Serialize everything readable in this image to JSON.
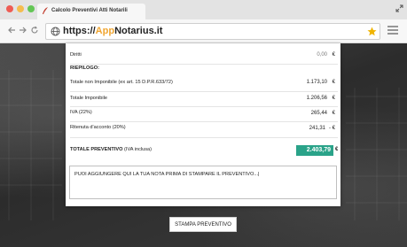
{
  "browser": {
    "tab_title": "Calcolo Preventivi Atti Notarili",
    "url_prefix": "https://",
    "url_accent": "App",
    "url_suffix": "Notarius.it"
  },
  "rows": [
    {
      "label": "Diritti",
      "value": "0,00",
      "currency": "€"
    },
    {
      "label": "RIEPILOGO:",
      "value": "",
      "currency": ""
    },
    {
      "label": "Totale non Imponibile (ex art. 15 D.P.R.633/72)",
      "value": "1.173,10",
      "currency": "€"
    },
    {
      "label": "Totale Imponibile",
      "value": "1.206,56",
      "currency": "€"
    },
    {
      "label": "IVA (22%)",
      "value": "265,44",
      "currency": "€"
    },
    {
      "label": "Ritenuta d'acconto (20%)",
      "value": "241,31",
      "currency": "- €"
    }
  ],
  "total": {
    "label": "TOTALE PREVENTIVO",
    "note": "(IVA inclusa)",
    "value": "2.403,79",
    "currency": "€"
  },
  "note_text": "PUOI AGGIUNGERE QUI LA TUA NOTA PRIMA DI STAMPARE IL PREVENTIVO...|",
  "print_button": "STAMPA PREVENTIVO",
  "colors": {
    "accent": "#f0a530",
    "total_bg": "#2aa389"
  }
}
